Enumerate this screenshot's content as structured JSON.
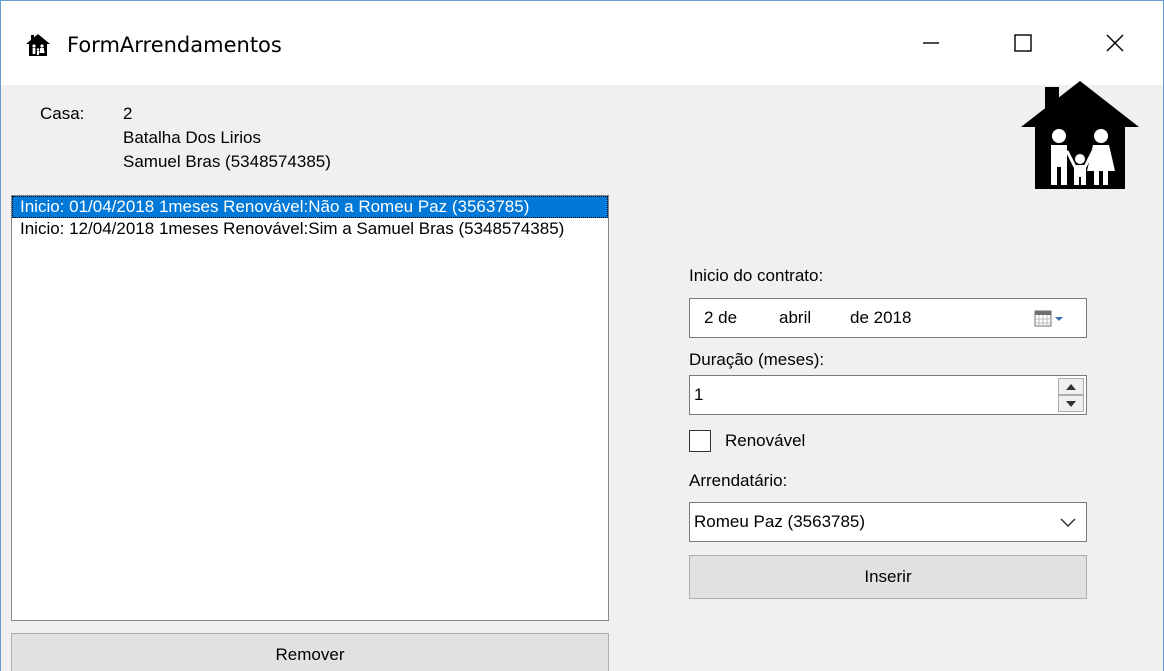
{
  "window": {
    "title": "FormArrendamentos",
    "icon": "house-family-icon",
    "controls": {
      "minimize": "minimize-icon",
      "maximize": "maximize-icon",
      "close": "close-icon"
    }
  },
  "info": {
    "casa_label": "Casa:",
    "casa_number": "2",
    "casa_address": "Batalha Dos Lirios",
    "casa_owner": "Samuel Bras (5348574385)"
  },
  "logo": "house-family-icon",
  "rentals": {
    "items": [
      {
        "text": "Inicio: 01/04/2018 1meses Renovável:Não a Romeu Paz (3563785)",
        "selected": true
      },
      {
        "text": "Inicio: 12/04/2018 1meses Renovável:Sim a Samuel Bras (5348574385)",
        "selected": false
      }
    ],
    "remove_label": "Remover"
  },
  "form": {
    "start_label": "Inicio do contrato:",
    "start_day": "2 de",
    "start_month": "abril",
    "start_year": "de 2018",
    "duration_label": "Duração (meses):",
    "duration_value": "1",
    "renewable_label": "Renovável",
    "renewable_checked": false,
    "tenant_label": "Arrendatário:",
    "tenant_value": "Romeu Paz (3563785)",
    "insert_label": "Inserir"
  },
  "colors": {
    "selection": "#0078d7",
    "window_bg": "#f0f0f0",
    "border_accent": "#6b9bd1"
  }
}
